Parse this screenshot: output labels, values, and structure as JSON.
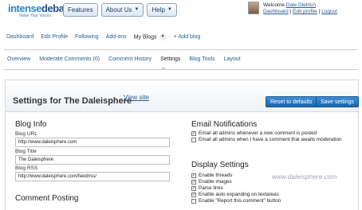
{
  "logo": {
    "part1": "intense",
    "part2": "debate",
    "tagline": "Value Your Voices"
  },
  "topnav": {
    "features": "Features",
    "about_us": "About Us",
    "help": "Help"
  },
  "user": {
    "welcome_prefix": "Welcome",
    "name": "Dale Dietrich",
    "links": {
      "dashboard": "Dashboard",
      "edit_profile": "Edit profile",
      "logout": "Logout"
    },
    "separator": "|"
  },
  "primary_nav": {
    "dashboard": "Dashboard",
    "edit_profile": "Edit Profile",
    "following": "Following",
    "add_ons": "Add-ons",
    "my_blogs": "My Blogs",
    "add_blog": "Add blog"
  },
  "secondary_nav": {
    "overview": "Overview",
    "moderate_comments": "Moderate Comments (0)",
    "comment_history": "Comment History",
    "settings": "Settings",
    "blog_tools": "Blog Tools",
    "layout": "Layout"
  },
  "panel": {
    "title": "Settings for The Daleisphere",
    "view_site": "View site",
    "reset_button": "Reset to defaults",
    "save_button": "Save settings"
  },
  "blog_info": {
    "heading": "Blog Info",
    "url_label": "Blog URL",
    "url_value": "http://www.daleisphere.com",
    "title_label": "Blog Title",
    "title_value": "The Daleisphere",
    "rss_label": "Blog RSS",
    "rss_value": "http://www.daleisphere.com/feed/rss/"
  },
  "comment_posting": {
    "heading": "Comment Posting"
  },
  "email_notifications": {
    "heading": "Email Notifications",
    "options": [
      {
        "label": "Email all admins whenever a new comment is posted",
        "checked": true
      },
      {
        "label": "Email all admins when I have a comment that awaits moderation",
        "checked": false
      }
    ]
  },
  "display_settings": {
    "heading": "Display Settings",
    "options": [
      {
        "label": "Enable threads",
        "checked": true
      },
      {
        "label": "Enable images",
        "checked": true
      },
      {
        "label": "Parse links",
        "checked": true
      },
      {
        "label": "Enable auto expanding on textareas",
        "checked": true
      },
      {
        "label": "Enable \"Report this comment\" button",
        "checked": false
      }
    ]
  },
  "watermark": "www.daleisphere.com",
  "colors": {
    "link": "#2a5d96",
    "button_blue": "#2a7ac4",
    "logo_blue": "#2a86c9"
  },
  "icons": {
    "dropdown": "chevron-down-icon",
    "checkbox_checked": "check-icon"
  }
}
